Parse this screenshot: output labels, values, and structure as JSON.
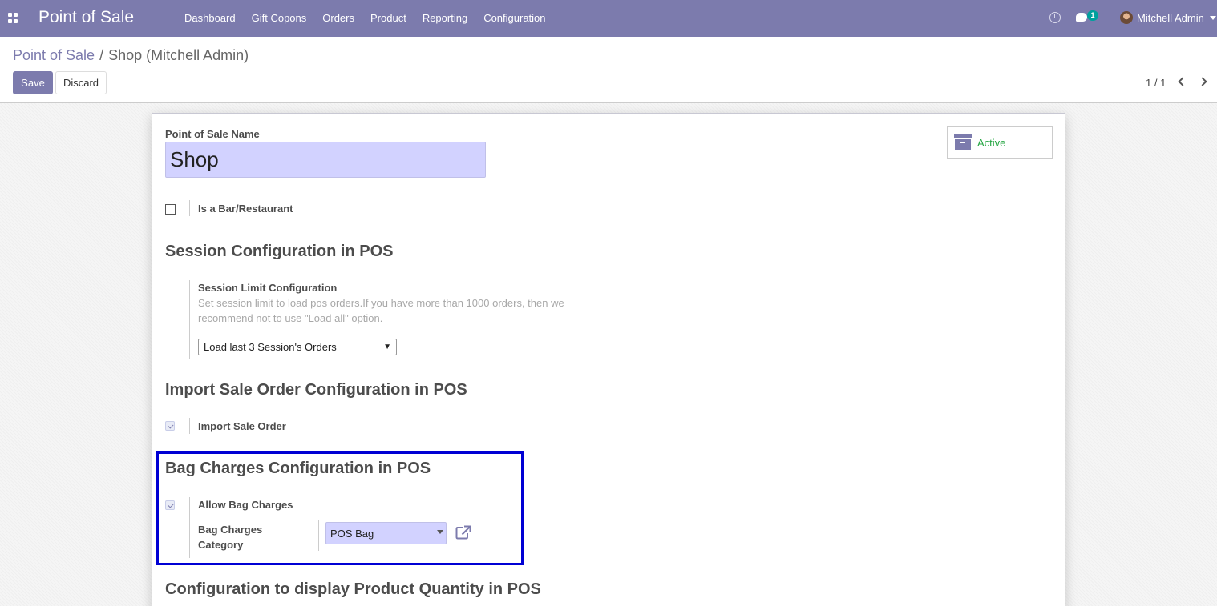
{
  "navbar": {
    "app_name": "Point of Sale",
    "menu": [
      "Dashboard",
      "Gift Copons",
      "Orders",
      "Product",
      "Reporting",
      "Configuration"
    ],
    "chat_count": "1",
    "user_name": "Mitchell Admin"
  },
  "breadcrumb": {
    "parent": "Point of Sale",
    "separator": "/",
    "current": "Shop (Mitchell Admin)"
  },
  "buttons": {
    "save": "Save",
    "discard": "Discard"
  },
  "pager": {
    "value": "1 / 1"
  },
  "form": {
    "name_label": "Point of Sale Name",
    "name_value": "Shop",
    "active_button": "Active",
    "is_bar_label": "Is a Bar/Restaurant",
    "is_bar_checked": false,
    "session_section_title": "Session Configuration in POS",
    "session_limit_label": "Session Limit Configuration",
    "session_limit_help": "Set session limit to load pos orders.If you have more than 1000 orders, then we recommend not to use \"Load all\" option.",
    "session_limit_value": "Load last 3 Session's Orders",
    "import_section_title": "Import Sale Order Configuration in POS",
    "import_sale_order_label": "Import Sale Order",
    "import_sale_order_checked": true,
    "bag_section_title": "Bag Charges Configuration in POS",
    "allow_bag_charges_label": "Allow Bag Charges",
    "allow_bag_charges_checked": true,
    "bag_category_label": "Bag Charges Category",
    "bag_category_value": "POS Bag",
    "product_qty_section_title": "Configuration to display Product Quantity in POS"
  },
  "colors": {
    "brand": "#7c7bad",
    "input_bg": "#d2d2ff",
    "active_green": "#28a745",
    "highlight_border": "#0000d4"
  }
}
